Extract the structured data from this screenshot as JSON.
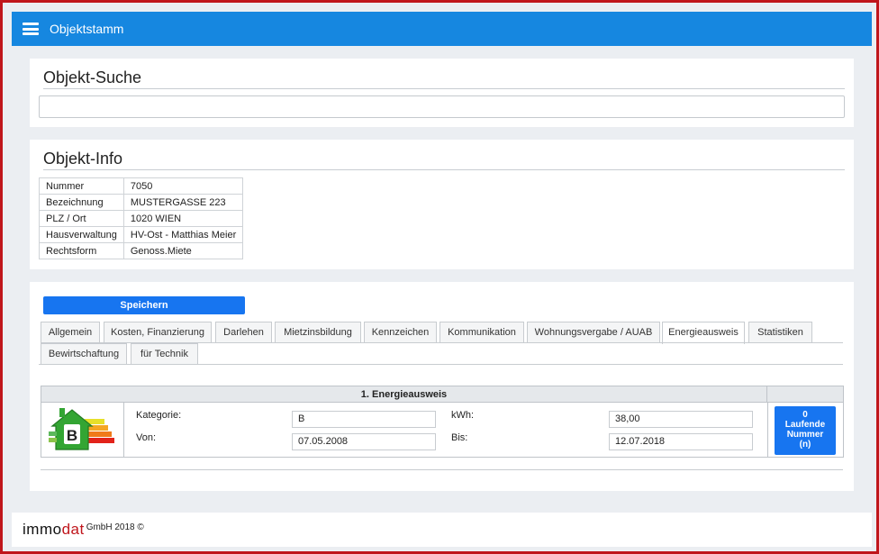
{
  "header": {
    "title": "Objektstamm"
  },
  "search": {
    "title": "Objekt-Suche",
    "value": "",
    "placeholder": ""
  },
  "info": {
    "title": "Objekt-Info",
    "rows": [
      {
        "label": "Nummer",
        "value": "7050"
      },
      {
        "label": "Bezeichnung",
        "value": "MUSTERGASSE 223"
      },
      {
        "label": "PLZ / Ort",
        "value": "1020 WIEN"
      },
      {
        "label": "Hausverwaltung",
        "value": "HV-Ost - Matthias Meier"
      },
      {
        "label": "Rechtsform",
        "value": "Genoss.Miete"
      }
    ]
  },
  "toolbar": {
    "save_label": "Speichern"
  },
  "tabs": [
    {
      "label": "Allgemein"
    },
    {
      "label": "Kosten, Finanzierung"
    },
    {
      "label": "Darlehen"
    },
    {
      "label": "Mietzinsbildung"
    },
    {
      "label": "Kennzeichen"
    },
    {
      "label": "Kommunikation"
    },
    {
      "label": "Wohnungsvergabe / AUAB"
    },
    {
      "label": "Energieausweis",
      "active": true
    },
    {
      "label": "Statistiken"
    },
    {
      "label": "Bewirtschaftung"
    },
    {
      "label": "für Technik"
    }
  ],
  "energy": {
    "heading": "1. Energieausweis",
    "icon": "energy-label-house-icon",
    "icon_letter": "B",
    "kategorie_label": "Kategorie:",
    "kategorie_value": "B",
    "kwh_label": "kWh:",
    "kwh_value": "38,00",
    "von_label": "Von:",
    "von_value": "07.05.2008",
    "bis_label": "Bis:",
    "bis_value": "12.07.2018",
    "lfd_count": "0",
    "lfd_label_1": "Laufende",
    "lfd_label_2": "Nummer",
    "lfd_label_3": "(n)"
  },
  "footer": {
    "brand_1": "immo",
    "brand_2": "dat",
    "copyright": "GmbH 2018 ©"
  },
  "colors": {
    "accent": "#1687e0",
    "button": "#1775f0",
    "frame": "#c0161c"
  }
}
